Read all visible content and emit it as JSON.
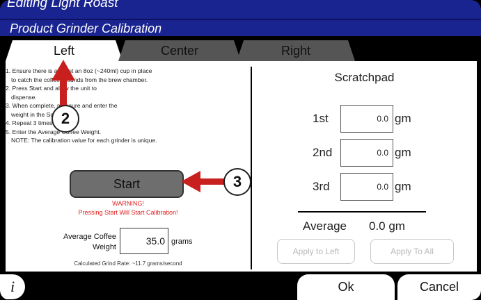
{
  "window": {
    "title": "Editing Light Roast",
    "subtitle": "Product Grinder Calibration"
  },
  "tabs": [
    {
      "label": "Left",
      "active": true
    },
    {
      "label": "Center",
      "active": false
    },
    {
      "label": "Right",
      "active": false
    }
  ],
  "left_panel": {
    "instructions": [
      "1. Ensure there is at least an 8oz (~240ml) cup in place",
      "to catch the coffee grounds from the brew chamber.",
      "2. Press Start and allow the unit to",
      "dispense.",
      "3. When complete, measure and enter the",
      "weight in the Scratchpad.",
      "4. Repeat 3 times.",
      "5. Enter the Average Coffee Weight.",
      "NOTE:  The calibration value for each grinder is unique."
    ],
    "start_label": "Start",
    "warning_title": "WARNING!",
    "warning_text": "Pressing Start Will Start Calibration!",
    "avg_label_line1": "Average Coffee",
    "avg_label_line2": "Weight",
    "avg_value": "35.0",
    "avg_unit": "grams",
    "grind_rate_text": "Calculated Grind Rate: ~11.7 grams/second"
  },
  "scratchpad": {
    "title": "Scratchpad",
    "rows": [
      {
        "label": "1st",
        "value": "0.0",
        "unit": "gm"
      },
      {
        "label": "2nd",
        "value": "0.0",
        "unit": "gm"
      },
      {
        "label": "3rd",
        "value": "0.0",
        "unit": "gm"
      }
    ],
    "average_label": "Average",
    "average_value": "0.0 gm",
    "apply_left_label": "Apply to Left",
    "apply_all_label": "Apply To All"
  },
  "bottom": {
    "info_glyph": "i",
    "ok_label": "Ok",
    "cancel_label": "Cancel"
  },
  "annotations": {
    "callout_2": "2",
    "callout_3": "3",
    "arrow_color": "#c8201e"
  },
  "colors": {
    "title_bar": "#1a2490",
    "tab_inactive": "#555555",
    "warning": "#e02020"
  }
}
